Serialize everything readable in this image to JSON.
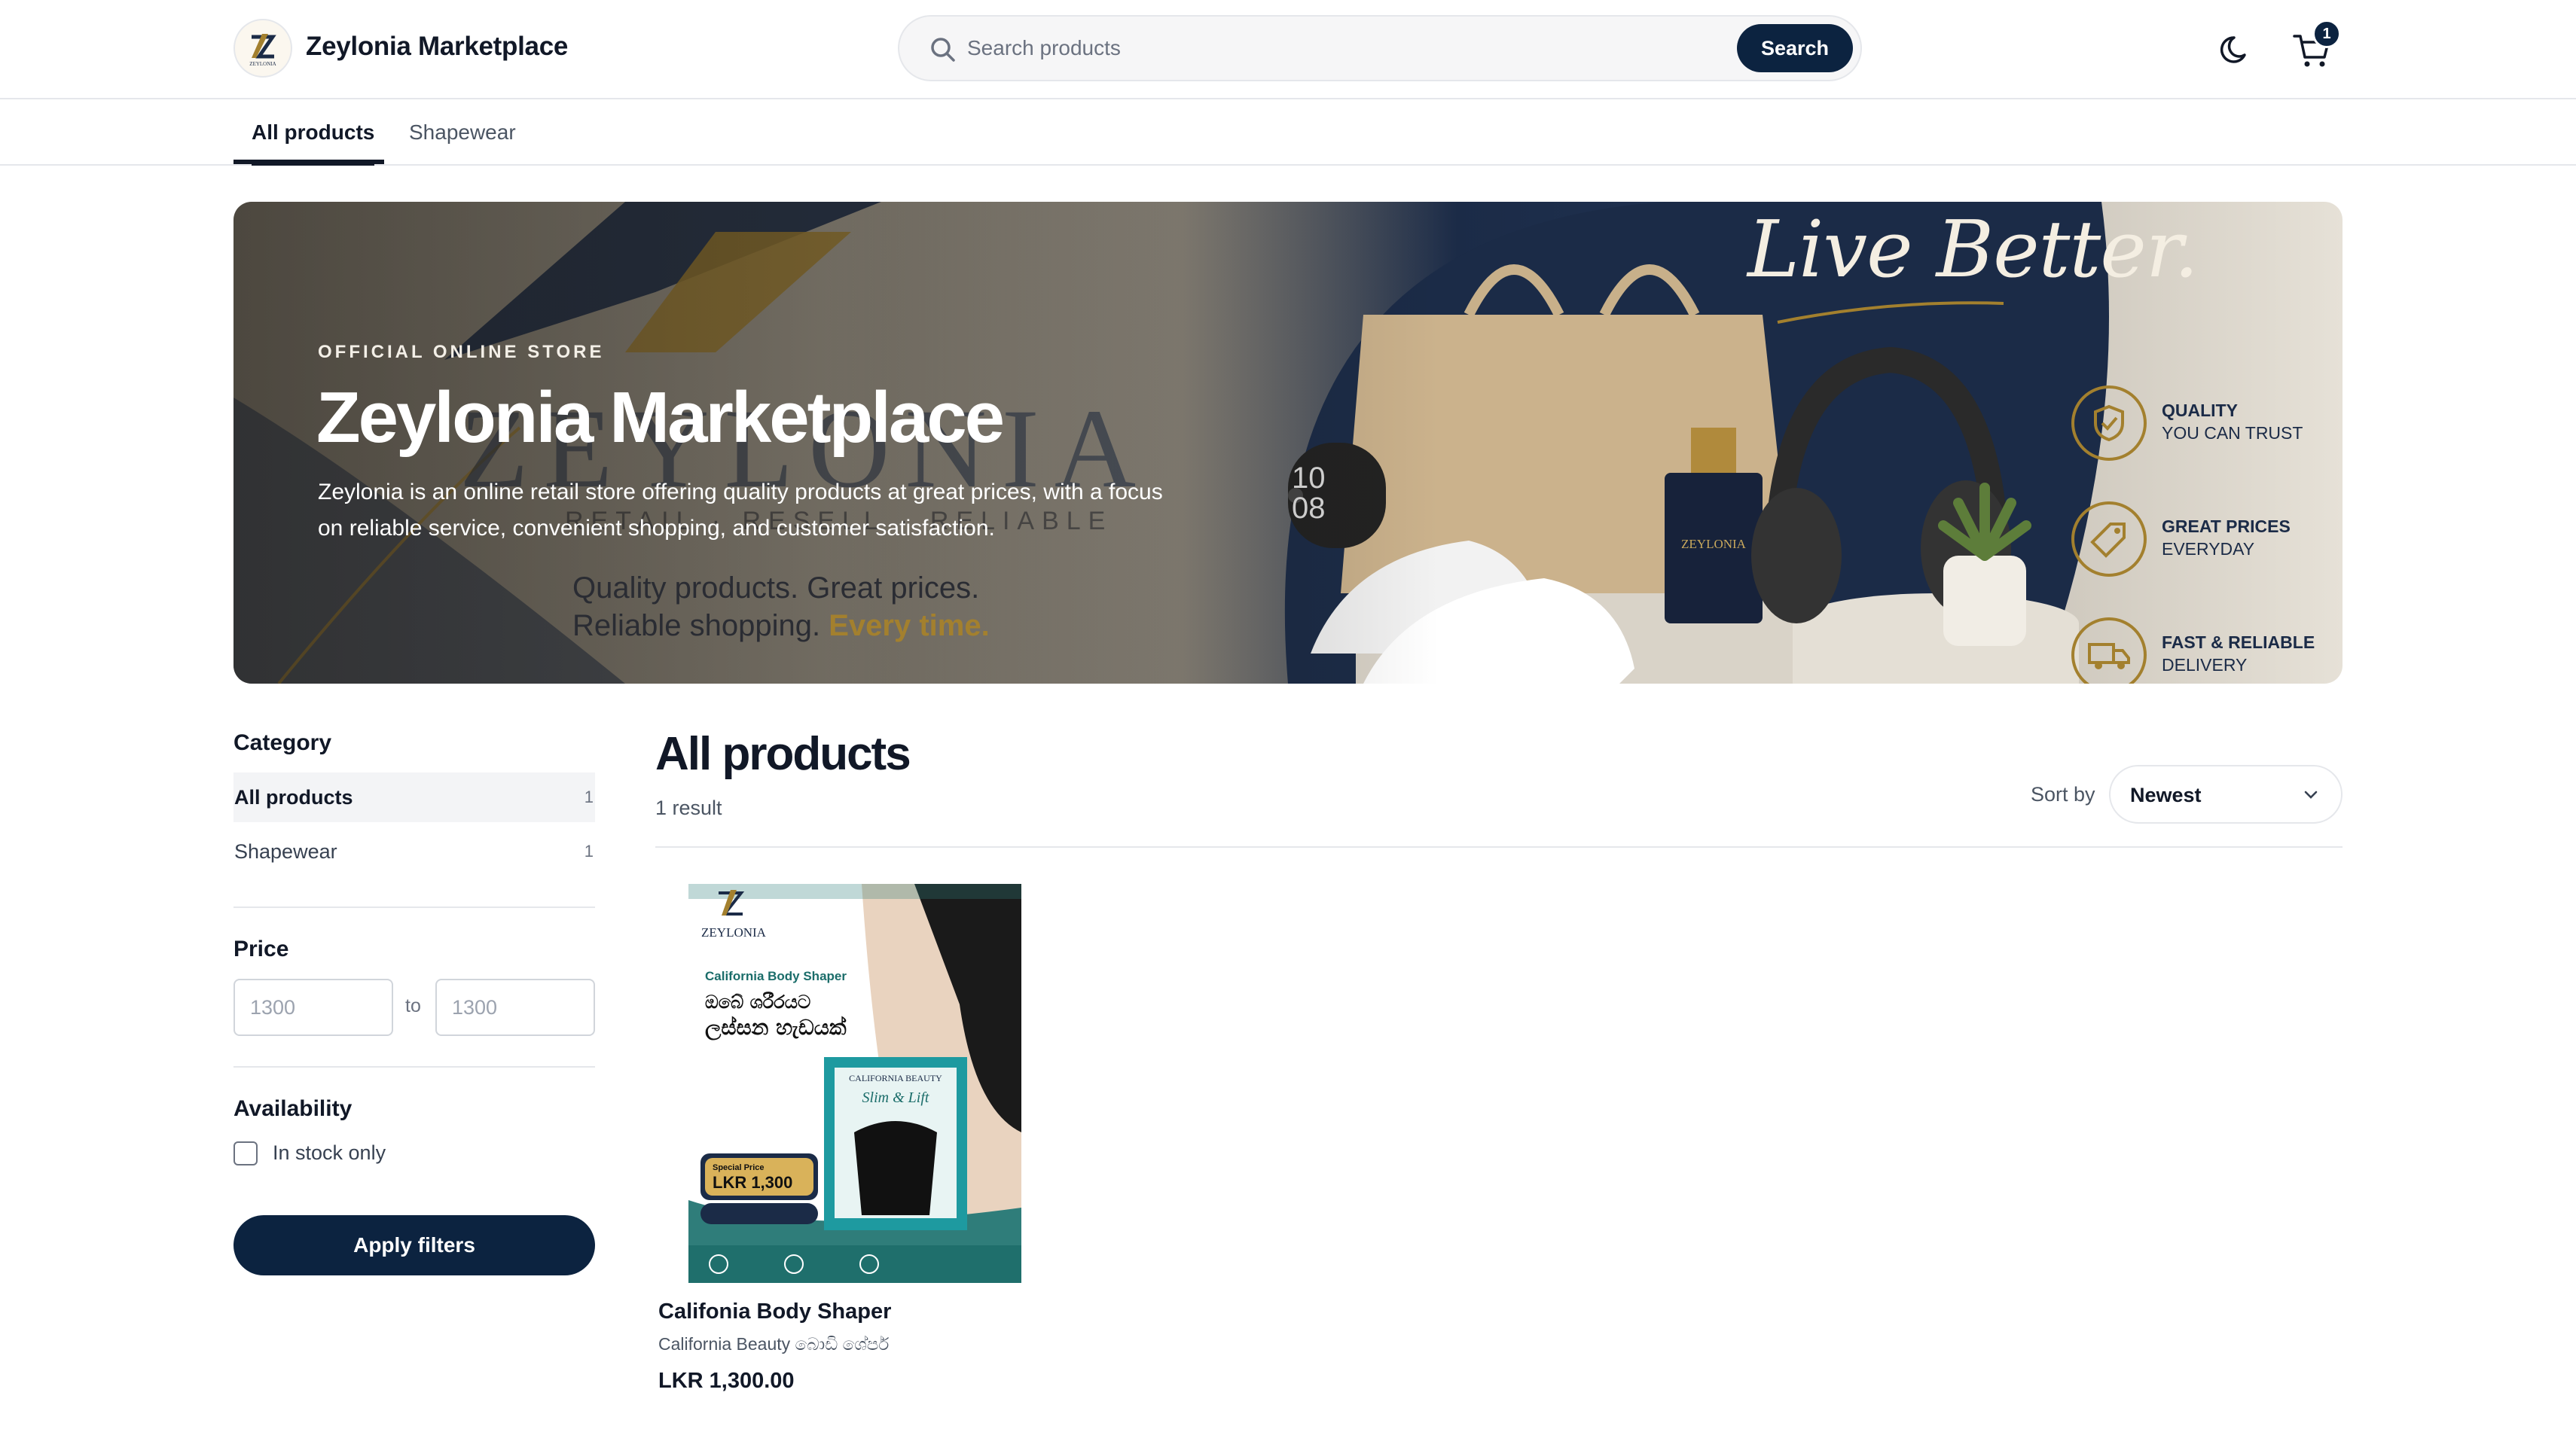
{
  "header": {
    "brand": "Zeylonia Marketplace",
    "search_placeholder": "Search products",
    "search_button": "Search",
    "cart_count": "1"
  },
  "nav": {
    "tabs": [
      {
        "label": "All products",
        "active": true
      },
      {
        "label": "Shapewear",
        "active": false
      }
    ]
  },
  "hero": {
    "eyebrow": "OFFICIAL ONLINE STORE",
    "title": "Zeylonia Marketplace",
    "description": "Zeylonia is an online retail store offering quality products at great prices, with a focus on reliable service, convenient shopping, and customer satisfaction.",
    "tagline_line1": "Quality products. Great prices.",
    "tagline_line2_a": "Reliable shopping. ",
    "tagline_line2_b": "Every time.",
    "script_text": "Live Better.",
    "features": [
      {
        "line1": "QUALITY",
        "line2": "YOU CAN TRUST",
        "icon": "shield-check-icon"
      },
      {
        "line1": "GREAT PRICES",
        "line2": "EVERYDAY",
        "icon": "price-tag-icon"
      },
      {
        "line1": "FAST & RELIABLE",
        "line2": "DELIVERY",
        "icon": "truck-icon"
      }
    ]
  },
  "sidebar": {
    "category_heading": "Category",
    "categories": [
      {
        "label": "All products",
        "count": "1",
        "active": true
      },
      {
        "label": "Shapewear",
        "count": "1",
        "active": false
      }
    ],
    "price_heading": "Price",
    "price_min_placeholder": "1300",
    "price_max_placeholder": "1300",
    "price_to": "to",
    "availability_heading": "Availability",
    "in_stock_label": "In stock only",
    "in_stock_checked": false,
    "apply_button": "Apply filters"
  },
  "results": {
    "title": "All products",
    "count": "1 result",
    "sort_label": "Sort by",
    "sort_value": "Newest"
  },
  "products": [
    {
      "name": "Califonia Body Shaper",
      "subtitle": "California Beauty බොඩි ශේපර්",
      "price": "LKR 1,300.00",
      "image_text": {
        "brand": "ZEYLONIA",
        "product": "California Body Shaper",
        "headline_1": "ඔබේ ශරීරයට",
        "headline_2": "ලස්සන හැඩයක්",
        "special_label": "Special Price",
        "special_price": "LKR 1,300",
        "box_brand": "CALIFORNIA BEAUTY",
        "box_name": "Slim & Lift"
      }
    }
  ],
  "colors": {
    "primary": "#0c2340",
    "accent_gold": "#a3802e",
    "border": "#e5e7eb"
  }
}
